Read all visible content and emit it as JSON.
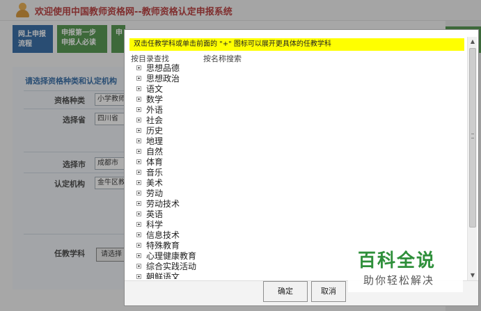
{
  "header": {
    "title": "欢迎使用中国教师资格网--教师资格认定申报系统"
  },
  "steps": [
    {
      "label": "网上申报流程"
    },
    {
      "label": "申报第一步 申报人必读"
    },
    {
      "label": "申"
    }
  ],
  "form": {
    "section_title": "请选择资格种类和认定机构",
    "qualification_label": "资格种类",
    "qualification_value": "小学教师",
    "province_label": "选择省",
    "province_value": "四川省",
    "city_label": "选择市",
    "city_value": "成都市",
    "agency_label": "认定机构",
    "agency_value": "金牛区教",
    "subject_label": "任教学科",
    "subject_button": "请选择"
  },
  "dialog": {
    "hint": "双击任教学科或单击前面的 \"+\" 图标可以展开更具体的任教学科",
    "tab_browse": "按目录查找",
    "tab_search": "按名称搜索",
    "subjects": [
      "思想品德",
      "思想政治",
      "语文",
      "数学",
      "外语",
      "社会",
      "历史",
      "地理",
      "自然",
      "体育",
      "音乐",
      "美术",
      "劳动",
      "劳动技术",
      "英语",
      "科学",
      "信息技术",
      "特殊教育",
      "心理健康教育",
      "综合实践活动",
      "朝鲜语文"
    ],
    "ok_label": "确定",
    "cancel_label": "取消"
  },
  "watermark": {
    "title": "百科全说",
    "subtitle": "助你轻松解决"
  }
}
